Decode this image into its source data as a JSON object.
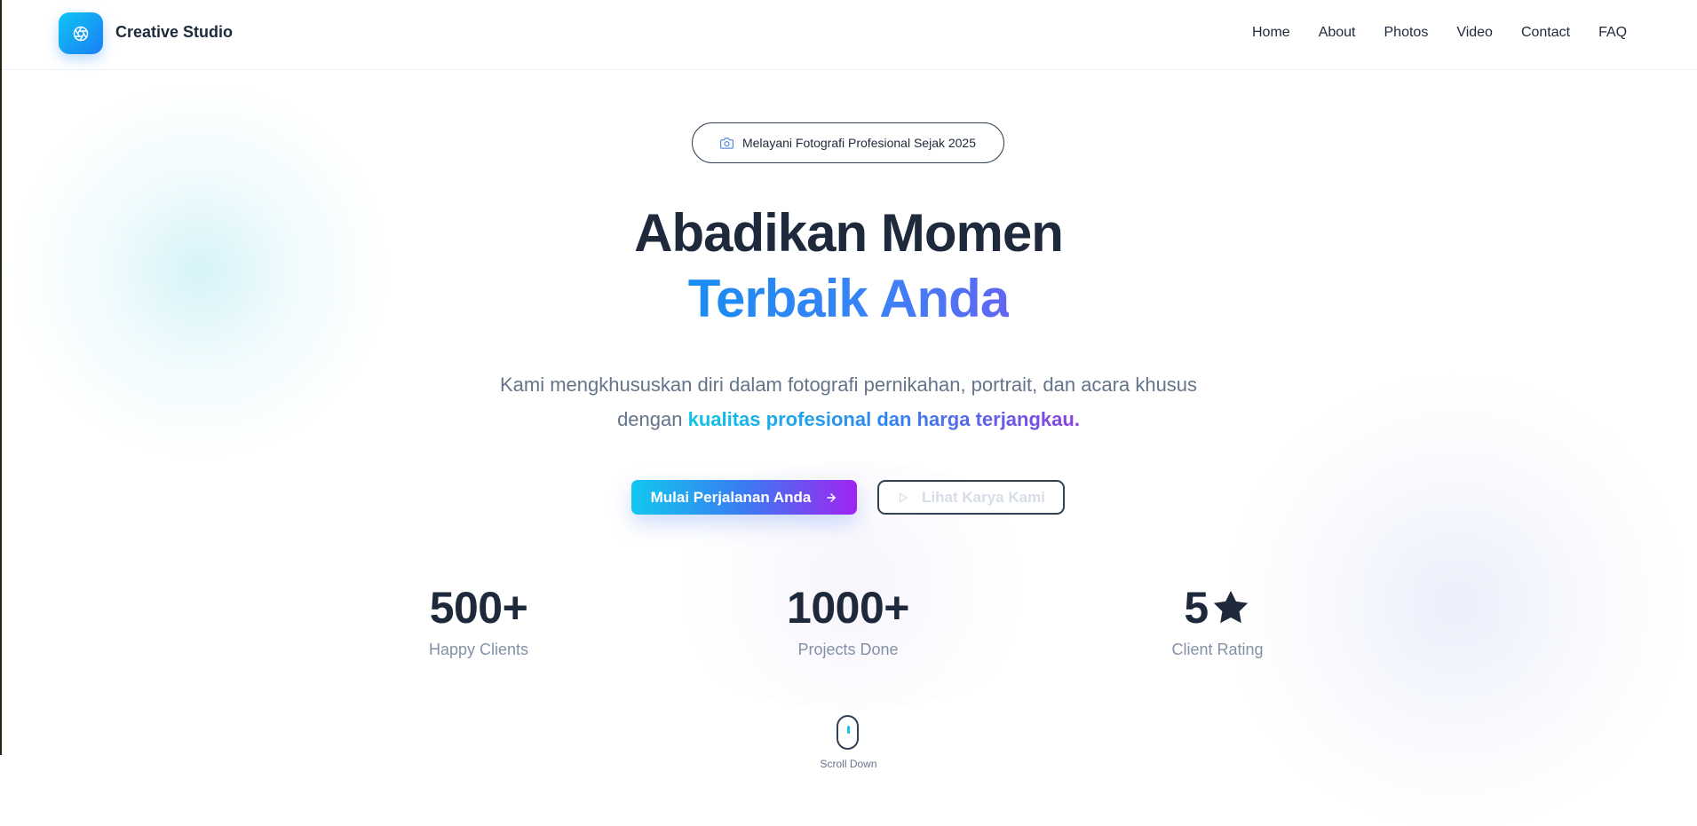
{
  "header": {
    "brand": "Creative Studio",
    "logo_icon": "aperture-icon",
    "nav": [
      "Home",
      "About",
      "Photos",
      "Video",
      "Contact",
      "FAQ"
    ]
  },
  "badge": {
    "icon": "camera-icon",
    "text": "Melayani Fotografi Profesional Sejak 2025"
  },
  "hero": {
    "title_line1": "Abadikan Momen",
    "title_line2": "Terbaik Anda",
    "desc_line1": "Kami mengkhususkan diri dalam fotografi pernikahan, portrait, dan acara khusus",
    "desc_line2_prefix": "dengan ",
    "desc_line2_highlight": "kualitas profesional dan harga terjangkau."
  },
  "buttons": {
    "primary": "Mulai Perjalanan Anda",
    "primary_icon": "arrow-right-icon",
    "secondary": "Lihat Karya Kami",
    "secondary_icon": "play-icon"
  },
  "stats": [
    {
      "value": "500+",
      "label": "Happy Clients"
    },
    {
      "value": "1000+",
      "label": "Projects Done"
    },
    {
      "value": "5",
      "suffix_icon": "star-icon",
      "label": "Client Rating"
    }
  ],
  "scroll": {
    "label": "Scroll Down"
  },
  "colors": {
    "text_dark": "#1e293b",
    "text_muted": "#64748b",
    "accent_cyan": "#12c8f0",
    "accent_blue": "#3a7cf2",
    "accent_purple": "#a024f0"
  }
}
